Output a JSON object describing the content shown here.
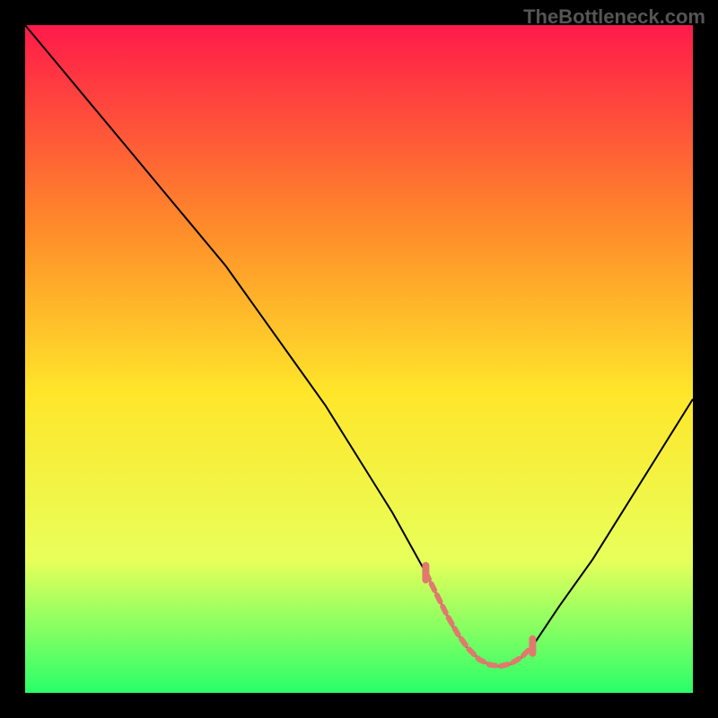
{
  "watermark": "TheBottleneck.com",
  "chart_data": {
    "type": "line",
    "title": "",
    "xlabel": "",
    "ylabel": "",
    "xlim": [
      0,
      100
    ],
    "ylim": [
      0,
      100
    ],
    "grid": false,
    "series": [
      {
        "name": "bottleneck-curve",
        "x": [
          0,
          5,
          10,
          15,
          20,
          25,
          30,
          35,
          40,
          45,
          50,
          55,
          60,
          62,
          64,
          66,
          68,
          70,
          72,
          74,
          76,
          78,
          80,
          85,
          90,
          95,
          100
        ],
        "values": [
          100,
          94,
          88,
          82,
          76,
          70,
          64,
          57,
          50,
          43,
          35,
          27,
          18,
          14,
          10,
          7,
          5,
          4,
          4,
          5,
          7,
          10,
          13,
          20,
          28,
          36,
          44
        ]
      }
    ],
    "optimal_zone": {
      "x_start": 60,
      "x_end": 76,
      "marker_color": "#e07a6f"
    },
    "background_gradient": {
      "top": "#ff1a4a",
      "mid_upper": "#ff8a2a",
      "mid": "#ffe62a",
      "mid_lower": "#e8ff5a",
      "bottom": "#2aff6a"
    },
    "frame_color": "#000000",
    "frame_thickness": 28,
    "curve_color": "#000000",
    "curve_width": 2
  }
}
